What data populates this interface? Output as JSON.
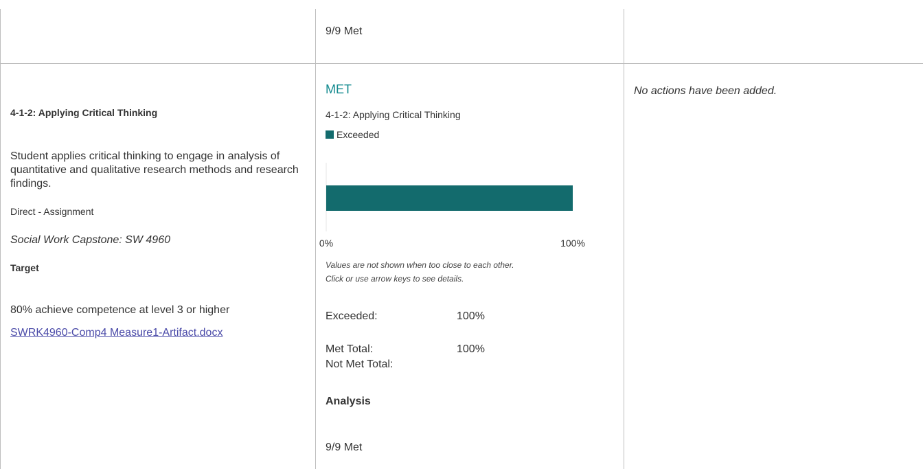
{
  "top_row": {
    "analysis_value": "9/9 Met"
  },
  "measure": {
    "title": "4-1-2: Applying Critical Thinking",
    "description": "Student applies critical thinking to engage in analysis of quantitative and qualitative research methods and research findings.",
    "method": "Direct - Assignment",
    "course": "Social Work Capstone: SW 4960",
    "target_label": "Target",
    "target_text": "80% achieve competence at level 3 or higher",
    "attachment": "SWRK4960-Comp4 Measure1-Artifact.docx"
  },
  "results": {
    "status": "MET",
    "chart_title": "4-1-2: Applying Critical Thinking",
    "legend_label": "Exceeded",
    "note_line1": "Values are not shown when too close to each other.",
    "note_line2": "Click or use arrow keys to see details.",
    "stats": [
      {
        "label": "Exceeded:",
        "value": "100%"
      },
      {
        "label": "Met Total:",
        "value": "100%"
      },
      {
        "label": "Not Met Total:",
        "value": ""
      }
    ],
    "analysis_label": "Analysis",
    "analysis_value": "9/9 Met"
  },
  "actions": {
    "empty_text": "No actions have been added."
  },
  "colors": {
    "bar": "#136b6d",
    "status": "#138a8f",
    "link": "#4a4aa8"
  },
  "chart_data": {
    "type": "bar",
    "orientation": "horizontal",
    "title": "4-1-2: Applying Critical Thinking",
    "series": [
      {
        "name": "Exceeded",
        "values": [
          100
        ]
      }
    ],
    "xlim": [
      0,
      100
    ],
    "x_tick_labels": [
      "0%",
      "100%"
    ]
  }
}
